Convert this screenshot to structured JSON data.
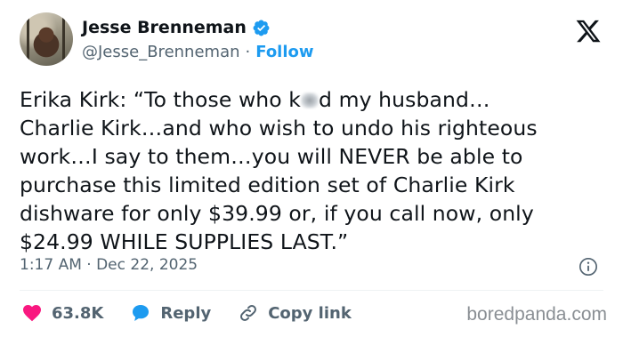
{
  "author": {
    "name": "Jesse Brenneman",
    "handle": "@Jesse_Brenneman",
    "separator": "·",
    "follow_label": "Follow",
    "verified": true,
    "verified_color": "#1d9bf0"
  },
  "tweet": {
    "text_part1": "Erika Kirk: “To those who k",
    "text_part2": "d my husband…\nCharlie Kirk…and who wish to undo his righteous work…I say to them…you will NEVER be able to purchase this limited edition set of Charlie Kirk dishware for only $39.99 or, if you call now, only $24.99 WHILE SUPPLIES LAST.”",
    "timestamp": "1:17 AM · Dec 22, 2025"
  },
  "actions": {
    "likes": "63.8K",
    "reply": "Reply",
    "copy_link": "Copy link",
    "like_color": "#f91880",
    "reply_color": "#1d9bf0"
  },
  "icons": {
    "x_logo": "x-logo-icon",
    "info": "info-icon",
    "heart": "heart-icon",
    "reply": "reply-bubble-icon",
    "link": "link-icon"
  },
  "watermark": "boredpanda.com"
}
